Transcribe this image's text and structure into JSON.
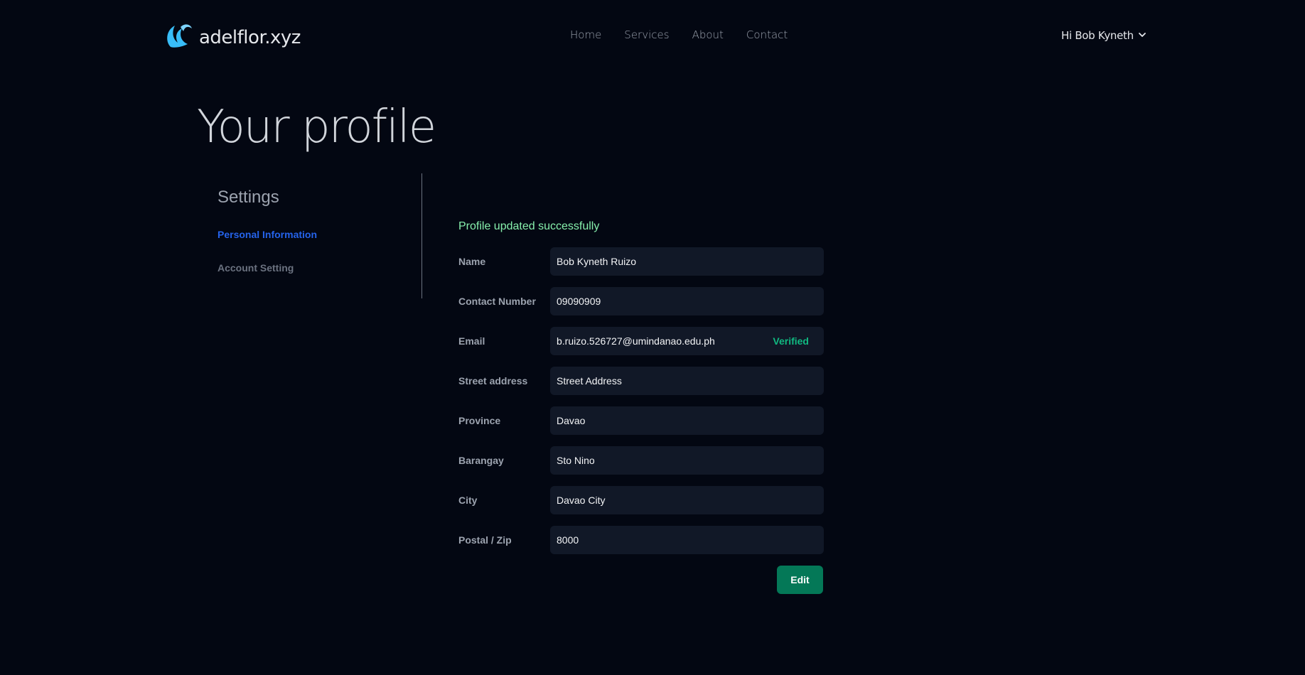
{
  "brand": {
    "name": "adelflor.xyz",
    "icon": "wave-logo-icon"
  },
  "nav": {
    "items": [
      {
        "label": "Home"
      },
      {
        "label": "Services"
      },
      {
        "label": "About"
      },
      {
        "label": "Contact"
      }
    ]
  },
  "user_menu": {
    "greeting": "Hi Bob Kyneth",
    "icon": "chevron-down-icon"
  },
  "page": {
    "title": "Your profile"
  },
  "sidebar": {
    "title": "Settings",
    "items": [
      {
        "label": "Personal Information",
        "active": true
      },
      {
        "label": "Account Setting",
        "active": false
      }
    ]
  },
  "form": {
    "status_message": "Profile updated successfully",
    "fields": [
      {
        "label": "Name",
        "value": "Bob Kyneth Ruizo"
      },
      {
        "label": "Contact Number",
        "value": "09090909"
      },
      {
        "label": "Email",
        "value": "b.ruizo.526727@umindanao.edu.ph",
        "badge": "Verified"
      },
      {
        "label": "Street address",
        "value": "Street Address"
      },
      {
        "label": "Province",
        "value": "Davao"
      },
      {
        "label": "Barangay",
        "value": "Sto Nino"
      },
      {
        "label": "City",
        "value": "Davao City"
      },
      {
        "label": "Postal / Zip",
        "value": "8000"
      }
    ],
    "edit_label": "Edit"
  },
  "colors": {
    "background": "#030712",
    "accent_link": "#2563eb",
    "success_text": "#86efac",
    "verified": "#10b981",
    "button": "#047857",
    "field_bg": "#111827"
  }
}
